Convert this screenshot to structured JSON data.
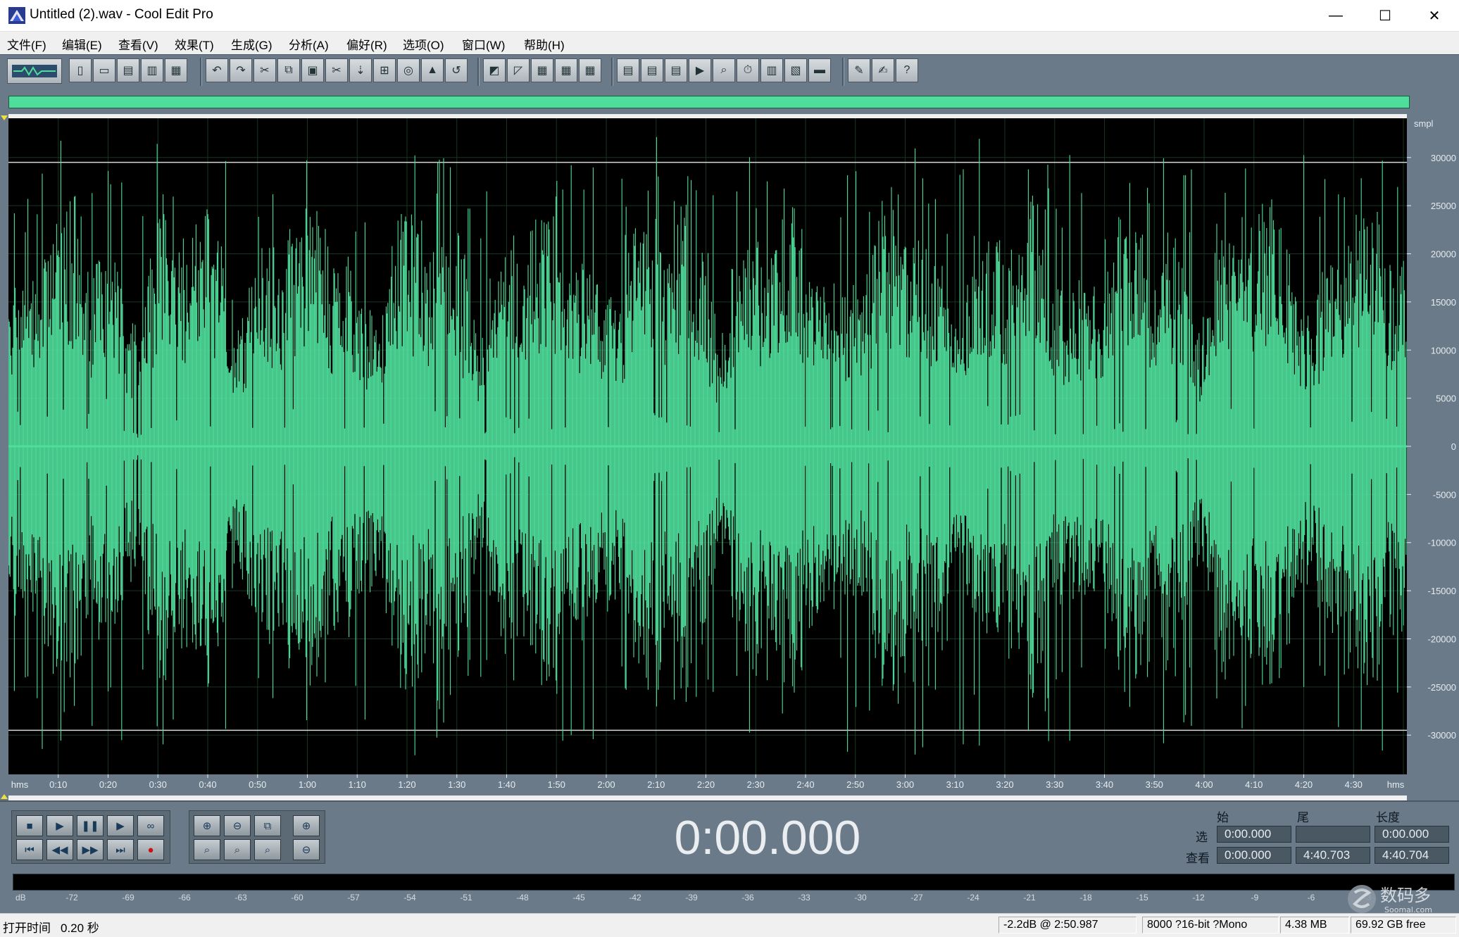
{
  "window": {
    "title": "Untitled (2).wav - Cool Edit Pro",
    "minimize_glyph": "—",
    "maximize_glyph": "☐",
    "close_glyph": "✕"
  },
  "menu": [
    "文件(F)",
    "编辑(E)",
    "查看(V)",
    "效果(T)",
    "生成(G)",
    "分析(A)",
    "偏好(R)",
    "选项(O)",
    "窗口(W)",
    "帮助(H)"
  ],
  "toolbar": {
    "groups": [
      [
        "new-file",
        "open-file",
        "save-file",
        "save-all",
        "save-selection"
      ],
      [
        "undo",
        "redo",
        "cut-tool",
        "copy",
        "paste",
        "cut",
        "paste-mix",
        "trim",
        "insert-cd",
        "normalize",
        "loop"
      ],
      [
        "select-all-wave",
        "snap",
        "view-1",
        "view-2",
        "view-3"
      ],
      [
        "settings-1",
        "settings-2",
        "settings-3",
        "play-view",
        "zoom-view",
        "time-display",
        "meter-view",
        "spectral-view",
        "bars-view"
      ],
      [
        "scripts",
        "edit-scripts",
        "help"
      ]
    ]
  },
  "waveform": {
    "color": "#4fdd9b",
    "background": "#000000",
    "amplitude_unit": "smpl",
    "amplitude_ticks": [
      "30000",
      "25000",
      "20000",
      "15000",
      "10000",
      "5000",
      "0",
      "-5000",
      "-10000",
      "-15000",
      "-20000",
      "-25000",
      "-30000"
    ],
    "time_unit": "hms",
    "time_ticks": [
      "0:10",
      "0:20",
      "0:30",
      "0:40",
      "0:50",
      "1:00",
      "1:10",
      "1:20",
      "1:30",
      "1:40",
      "1:50",
      "2:00",
      "2:10",
      "2:20",
      "2:30",
      "2:40",
      "2:50",
      "3:00",
      "3:10",
      "3:20",
      "3:30",
      "3:40",
      "3:50",
      "4:00",
      "4:10",
      "4:20",
      "4:30"
    ],
    "duration_seconds": 280.704,
    "clip_threshold": 29500
  },
  "transport": {
    "time": "0:00.000",
    "buttons": [
      "stop",
      "play",
      "pause",
      "play-to-end",
      "loop",
      "go-to-start",
      "rewind",
      "fast-forward",
      "go-to-end",
      "record"
    ],
    "zoom_buttons": [
      "zoom-in",
      "zoom-out",
      "zoom-full",
      "zoom-selection",
      "zoom-left",
      "zoom-right",
      "zoom-in-vertical",
      "zoom-out-vertical"
    ]
  },
  "selection": {
    "head_begin": "始",
    "head_end": "尾",
    "head_length": "长度",
    "row_sel_label": "选",
    "row_view_label": "查看",
    "sel_begin": "0:00.000",
    "sel_end": "",
    "sel_length": "0:00.000",
    "view_begin": "0:00.000",
    "view_end": "4:40.703",
    "view_length": "4:40.704"
  },
  "level_meter": {
    "unit": "dB",
    "ticks": [
      "-72",
      "-69",
      "-66",
      "-63",
      "-60",
      "-57",
      "-54",
      "-51",
      "-48",
      "-45",
      "-42",
      "-39",
      "-36",
      "-33",
      "-30",
      "-27",
      "-24",
      "-21",
      "-18",
      "-15",
      "-12",
      "-9",
      "-6",
      "-3"
    ]
  },
  "status": {
    "open_time_label": "打开时间",
    "open_time_value": "0.20 秒",
    "peak": "-2.2dB @  2:50.987",
    "format": "8000 ?16-bit ?Mono",
    "size": "4.38 MB",
    "free": "69.92 GB free"
  },
  "watermark": {
    "text": "数码多",
    "subtext": "Soomal.com"
  }
}
